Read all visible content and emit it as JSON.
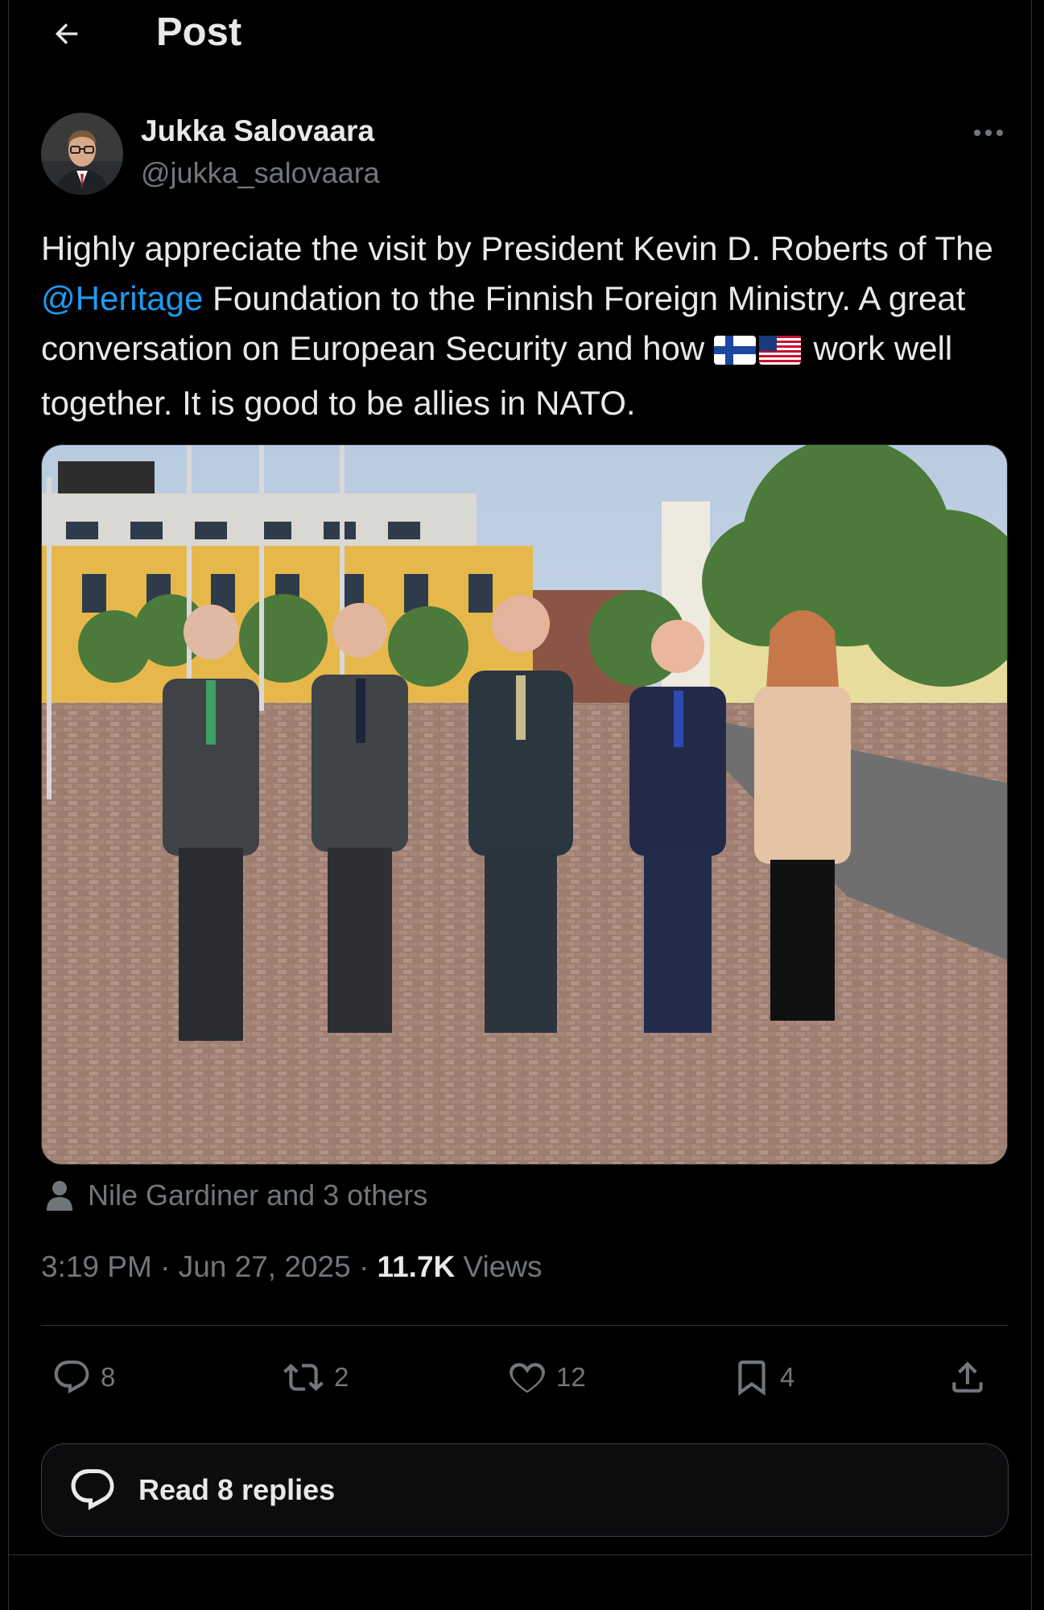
{
  "header": {
    "title": "Post"
  },
  "author": {
    "display_name": "Jukka Salovaara",
    "handle": "@jukka_salovaara"
  },
  "post": {
    "text_before_mention": "Highly appreciate the visit by President Kevin D. Roberts of The ",
    "mention": "@Heritage",
    "text_after_mention": " Foundation to the Finnish Foreign Ministry. A great conversation on European Security and how ",
    "flags": [
      "🇫🇮",
      "🇺🇸"
    ],
    "text_end": " work well together. It is good to be allies in NATO.",
    "tagged": "Nile Gardiner and 3 others",
    "time": "3:19 PM",
    "date": "Jun 27, 2025",
    "views_count": "11.7K",
    "views_label": "Views"
  },
  "actions": {
    "replies": "8",
    "reposts": "2",
    "likes": "12",
    "bookmarks": "4"
  },
  "read_replies": "Read 8 replies",
  "colors": {
    "accent": "#1d9bf0",
    "muted": "#71767b",
    "text": "#e7e9ea",
    "background": "#000000"
  },
  "icons": [
    "back-arrow-icon",
    "more-icon",
    "person-icon",
    "reply-icon",
    "repost-icon",
    "like-icon",
    "bookmark-icon",
    "share-icon",
    "speech-bubble-icon"
  ]
}
